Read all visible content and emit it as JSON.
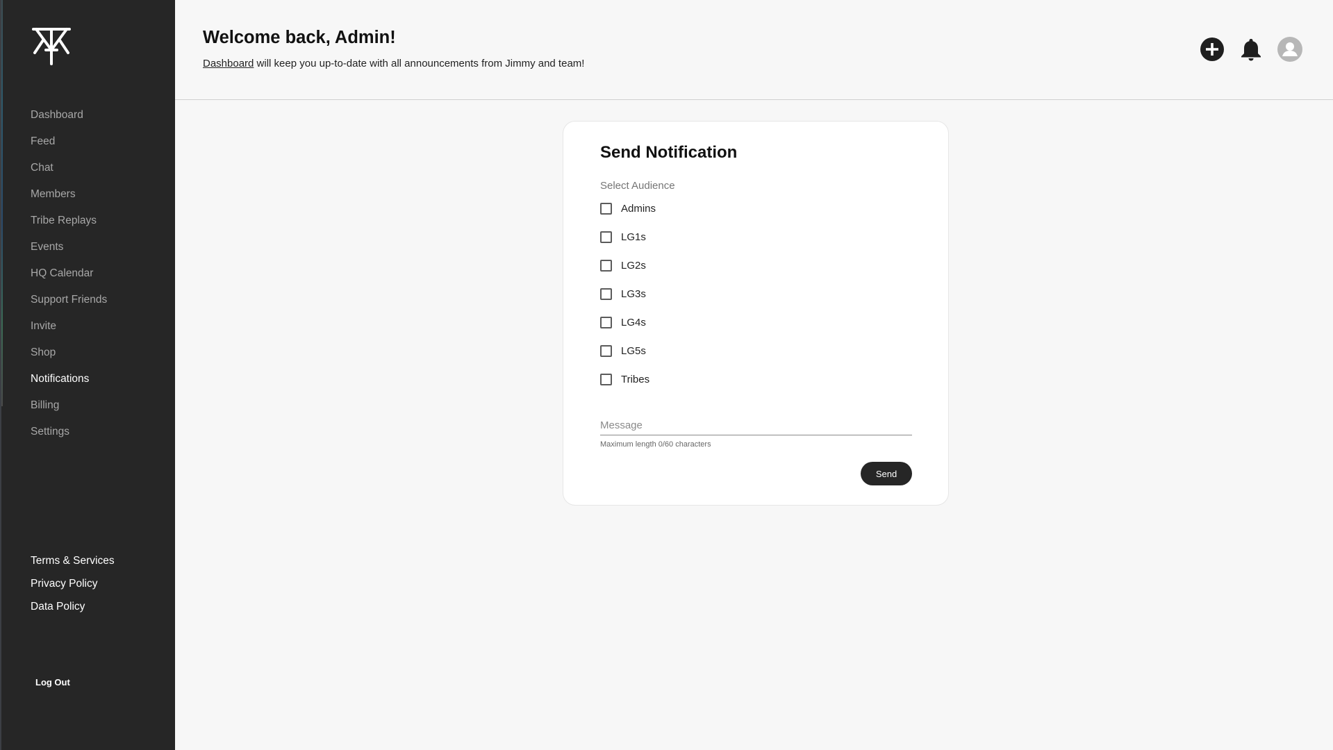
{
  "sidebar": {
    "logo_icon": "tribe-logo-icon",
    "items": [
      {
        "label": "Dashboard",
        "active": false
      },
      {
        "label": "Feed",
        "active": false
      },
      {
        "label": "Chat",
        "active": false
      },
      {
        "label": "Members",
        "active": false
      },
      {
        "label": "Tribe Replays",
        "active": false
      },
      {
        "label": "Events",
        "active": false
      },
      {
        "label": "HQ Calendar",
        "active": false
      },
      {
        "label": "Support Friends",
        "active": false
      },
      {
        "label": "Invite",
        "active": false
      },
      {
        "label": "Shop",
        "active": false
      },
      {
        "label": "Notifications",
        "active": true
      },
      {
        "label": "Billing",
        "active": false
      },
      {
        "label": "Settings",
        "active": false
      }
    ],
    "legal": [
      "Terms & Services",
      "Privacy Policy",
      "Data Policy"
    ],
    "logout_label": "Log Out"
  },
  "header": {
    "title": "Welcome back, Admin!",
    "subtitle_link": "Dashboard",
    "subtitle_rest": " will keep you up-to-date with all announcements from Jimmy and team!",
    "icons": [
      "add-circle-icon",
      "bell-icon",
      "user-avatar-icon"
    ]
  },
  "card": {
    "title": "Send Notification",
    "audience_label": "Select Audience",
    "options": [
      {
        "label": "Admins",
        "checked": false
      },
      {
        "label": "LG1s",
        "checked": false
      },
      {
        "label": "LG2s",
        "checked": false
      },
      {
        "label": "LG3s",
        "checked": false
      },
      {
        "label": "LG4s",
        "checked": false
      },
      {
        "label": "LG5s",
        "checked": false
      },
      {
        "label": "Tribes",
        "checked": false
      }
    ],
    "message": {
      "placeholder": "Message",
      "value": ""
    },
    "helper_text": "Maximum length 0/60 characters",
    "send_label": "Send"
  },
  "colors": {
    "sidebar_bg": "#262626",
    "page_bg": "#f7f7f7",
    "card_bg": "#ffffff",
    "button_bg": "#262626",
    "nav_inactive": "#a8a8a8",
    "nav_active": "#ffffff"
  }
}
